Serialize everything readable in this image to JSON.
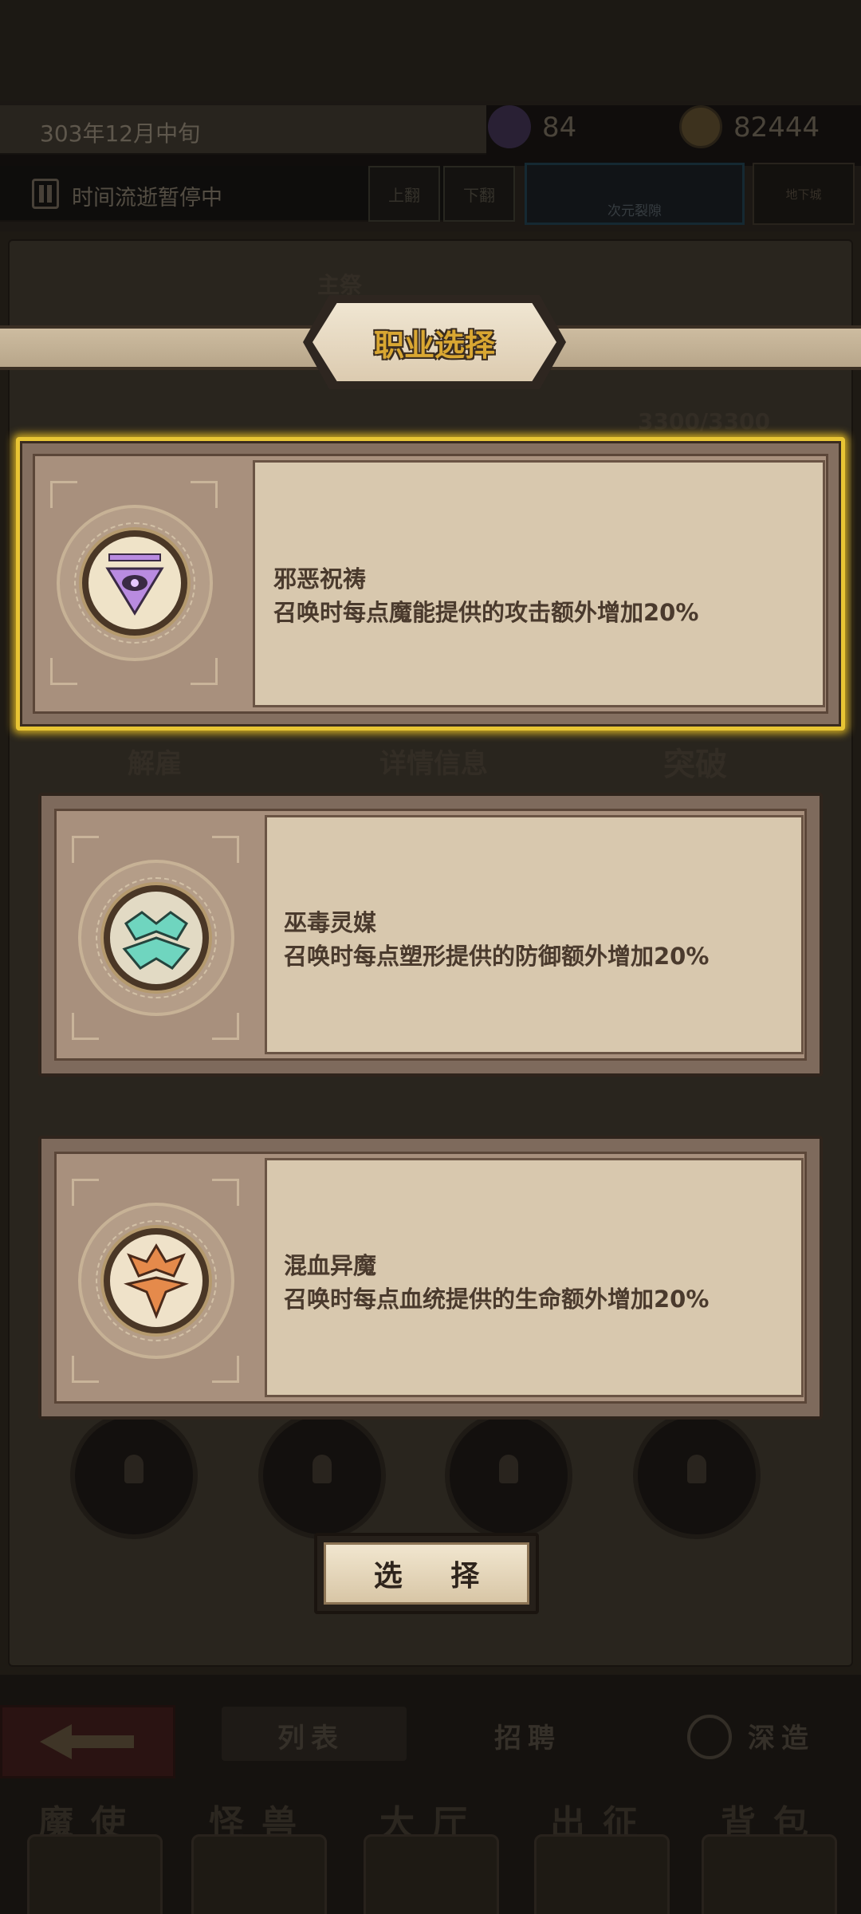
{
  "header": {
    "date": "303年12月中旬",
    "crystals": "84",
    "coins": "82444",
    "pause_text": "时间流逝暂停中",
    "tab_up": "上翻",
    "tab_down": "下翻",
    "rift_label": "次元裂隙",
    "side_label": "地下城",
    "hp_ghost": "3300/3300",
    "sacrifice_tag": "主祭"
  },
  "dialog": {
    "title": "职业选择",
    "classes": [
      {
        "name": "邪恶祝祷",
        "desc": "召唤时每点魔能提供的攻击额外增加20%",
        "icon": "evil-eye-icon",
        "color": "#b98be0",
        "selected": true
      },
      {
        "name": "巫毒灵媒",
        "desc": "召唤时每点塑形提供的防御额外增加20%",
        "icon": "voodoo-mask-icon",
        "color": "#6fd5bf",
        "selected": false
      },
      {
        "name": "混血异魔",
        "desc": "召唤时每点血统提供的生命额外增加20%",
        "icon": "hybrid-demon-icon",
        "color": "#e58a4b",
        "selected": false
      }
    ],
    "select_button": "选 择"
  },
  "background": {
    "ghost_buttons": [
      "解雇",
      "详情信息",
      "突破"
    ],
    "sub_tabs": [
      "列表",
      "招聘",
      "深造"
    ],
    "nav": [
      "魔使",
      "怪兽",
      "大厅",
      "出征",
      "背包"
    ]
  },
  "colors": {
    "accent_gold": "#e8c534",
    "title_gold": "#d9a732",
    "parchment": "#d8c8ae"
  }
}
